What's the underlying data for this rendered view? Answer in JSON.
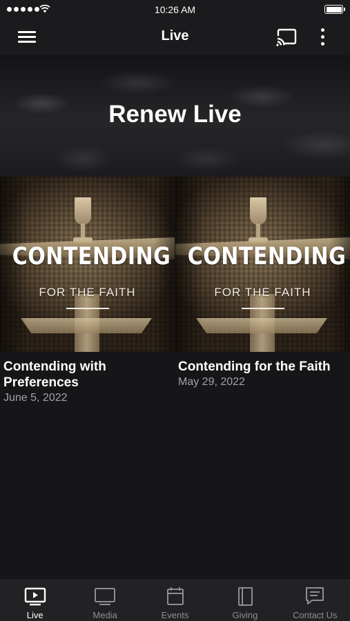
{
  "status_bar": {
    "time": "10:26 AM"
  },
  "nav": {
    "title": "Live"
  },
  "hero": {
    "title": "Renew Live"
  },
  "cards": [
    {
      "thumb_headline": "CONTENDING",
      "thumb_subhead": "FOR THE FAITH",
      "title": "Contending with Preferences",
      "date": "June 5, 2022"
    },
    {
      "thumb_headline": "CONTENDING",
      "thumb_subhead": "FOR THE FAITH",
      "title": "Contending for the Faith",
      "date": "May 29, 2022"
    }
  ],
  "tabs": [
    {
      "label": "Live",
      "icon": "play-screen-icon",
      "active": true
    },
    {
      "label": "Media",
      "icon": "monitor-icon",
      "active": false
    },
    {
      "label": "Events",
      "icon": "calendar-icon",
      "active": false
    },
    {
      "label": "Giving",
      "icon": "book-icon",
      "active": false
    },
    {
      "label": "Contact Us",
      "icon": "message-icon",
      "active": false
    }
  ],
  "colors": {
    "background": "#161618",
    "bar": "#1b1b1d",
    "tab_bar": "#222224",
    "active_tab": "#ffffff",
    "inactive_tab": "#8e8e93",
    "secondary_text": "#a3a3a8"
  }
}
